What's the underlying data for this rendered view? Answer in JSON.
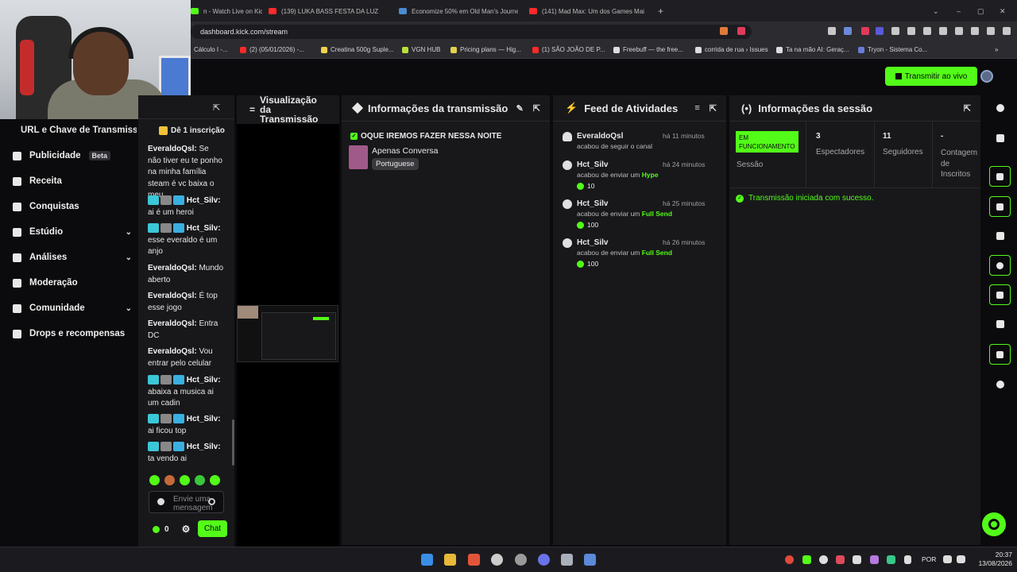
{
  "browser": {
    "tabs": [
      {
        "label": "n - Watch Live on Kick",
        "color": "#53fc18"
      },
      {
        "label": "(139) LUKA BASS FESTA DA LUZ",
        "color": "#ff2a2a"
      },
      {
        "label": "Economize 50% em Old Man's Journe",
        "color": "#4a8bd1"
      },
      {
        "label": "(141) Mad Max: Um dos Games Mai",
        "color": "#ff2a2a"
      }
    ],
    "new_tab": "+",
    "url": "dashboard.kick.com/stream",
    "bookmarks": [
      {
        "label": "Cálculo I -...",
        "color": "#3a6fd8"
      },
      {
        "label": "(2) (05/01/2026) -...",
        "color": "#ff2a2a"
      },
      {
        "label": "Creatina 500g Suple...",
        "color": "#f2d34a"
      },
      {
        "label": "VGN HUB",
        "color": "#b8e03a"
      },
      {
        "label": "Pricing plans — Hig...",
        "color": "#e5d14a"
      },
      {
        "label": "(1) SÃO JOÃO DE P...",
        "color": "#ff2a2a"
      },
      {
        "label": "Freebuff — the free...",
        "color": "#dddddd"
      },
      {
        "label": "corrida de rua › Issues",
        "color": "#dddddd"
      },
      {
        "label": "Ta na mão AI: Geraç...",
        "color": "#dddddd"
      },
      {
        "label": "Tryon - Sistema Co...",
        "color": "#6a7bd8"
      }
    ]
  },
  "header": {
    "go_live": "Transmitir ao vivo",
    "accent": "#53fc18"
  },
  "sidebar": {
    "title": "URL e Chave de Transmissã",
    "items": [
      {
        "label": "Publicidade",
        "badge": "Beta",
        "icon": "megaphone-icon"
      },
      {
        "label": "Receita",
        "icon": "chart-icon"
      },
      {
        "label": "Conquistas",
        "icon": "trophy-icon"
      },
      {
        "label": "Estúdio",
        "icon": "layout-icon",
        "expandable": true
      },
      {
        "label": "Análises",
        "icon": "analytics-icon",
        "expandable": true
      },
      {
        "label": "Moderação",
        "icon": "wrench-icon"
      },
      {
        "label": "Comunidade",
        "icon": "community-icon",
        "expandable": true
      },
      {
        "label": "Drops e recompensas",
        "icon": "drops-icon"
      }
    ]
  },
  "chat": {
    "sub_banner": "Dê 1 inscrição",
    "messages": [
      {
        "user": "EveraldoQsl",
        "text": "Se não tiver eu te ponho na minha família steam é vc baixa o meu",
        "badges": false
      },
      {
        "user": "Hct_Silv",
        "text": "ai é um heroi",
        "badges": true
      },
      {
        "user": "Hct_Silv",
        "text": "esse everaldo é um anjo",
        "badges": true
      },
      {
        "user": "EveraldoQsl",
        "text": "Mundo aberto",
        "badges": false
      },
      {
        "user": "EveraldoQsl",
        "text": "É top esse jogo",
        "badges": false
      },
      {
        "user": "EveraldoQsl",
        "text": "Entra DC",
        "badges": false
      },
      {
        "user": "EveraldoQsl",
        "text": "Vou entrar pelo celular",
        "badges": false
      },
      {
        "user": "Hct_Silv",
        "text": "abaixa a musica ai um cadin",
        "badges": true
      },
      {
        "user": "Hct_Silv",
        "text": "ai ficou top",
        "badges": true
      },
      {
        "user": "Hct_Silv",
        "text": "ta vendo ai",
        "badges": true
      }
    ],
    "input_placeholder": "Envie uma mensagem",
    "points": "0",
    "send_label": "Chat"
  },
  "preview": {
    "title": "Visualização da Transmissão"
  },
  "stream_info": {
    "title": "Informações da transmissão",
    "stream_title": "OQUE IREMOS FAZER NESSA NOITE",
    "category": "Apenas Conversa",
    "language": "Portuguese"
  },
  "activity": {
    "title": "Feed de Atividades",
    "items": [
      {
        "user": "EveraldoQsl",
        "time": "há 11 minutos",
        "desc": "acabou de seguir o canal",
        "highlight": "",
        "amount": "",
        "icon": "heart-icon"
      },
      {
        "user": "Hct_Silv",
        "time": "há 24 minutos",
        "desc": "acabou de enviar um",
        "highlight": "Hype",
        "amount": "10",
        "icon": "kick-coin-icon"
      },
      {
        "user": "Hct_Silv",
        "time": "há 25 minutos",
        "desc": "acabou de enviar um",
        "highlight": "Full Send",
        "amount": "100",
        "icon": "kick-coin-icon"
      },
      {
        "user": "Hct_Silv",
        "time": "há 26 minutos",
        "desc": "acabou de enviar um",
        "highlight": "Full Send",
        "amount": "100",
        "icon": "kick-coin-icon"
      }
    ]
  },
  "session": {
    "title": "Informações da sessão",
    "status_badge": "EM FUNCIONAMENTO",
    "status_label": "Sessão",
    "viewers": "3",
    "viewers_label": "Espectadores",
    "followers": "11",
    "followers_label": "Seguidores",
    "subs": "-",
    "subs_label": "Contagem de Inscritos",
    "success_msg": "Transmissão iniciada com sucesso."
  },
  "taskbar": {
    "language": "POR",
    "time": "20:37",
    "date": "13/08/2026"
  }
}
